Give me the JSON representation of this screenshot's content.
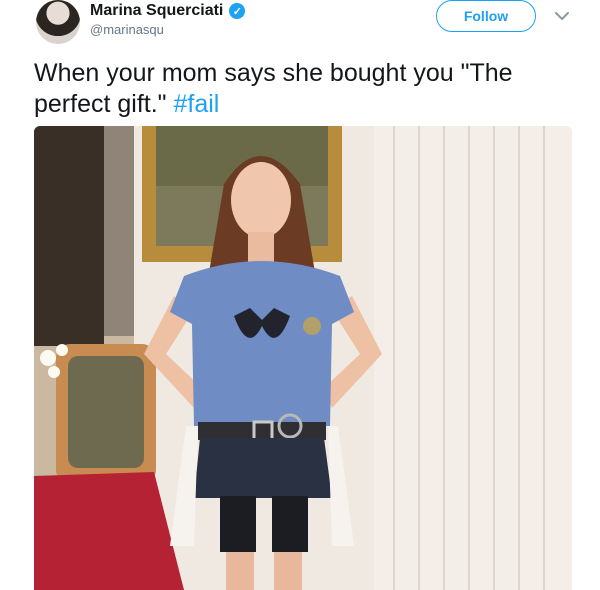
{
  "tweet": {
    "author": {
      "name": "Marina Squerciati",
      "handle": "@marinasqu",
      "verified": true
    },
    "follow_label": "Follow",
    "text": "When your mom says she bought you \"The perfect gift.\"",
    "hashtag": "#fail",
    "colors": {
      "accent": "#1da1f2",
      "text": "#14171a",
      "secondary": "#657786"
    }
  }
}
